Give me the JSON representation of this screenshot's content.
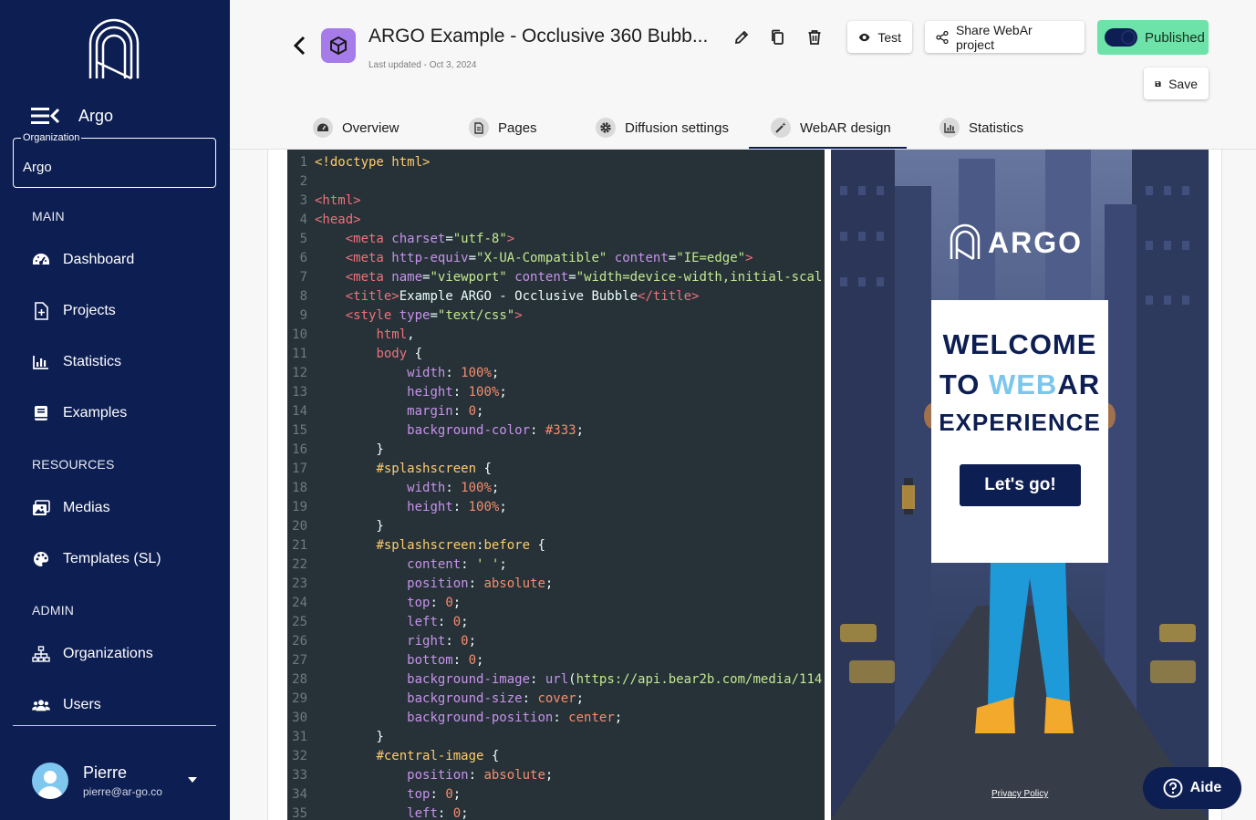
{
  "sidebar": {
    "org_label": "Argo",
    "org_field": {
      "legend": "Organization",
      "value": "Argo"
    },
    "sections": {
      "main": "MAIN",
      "resources": "RESOURCES",
      "admin": "ADMIN"
    },
    "items": [
      {
        "label": "Dashboard",
        "icon": "dashboard-icon"
      },
      {
        "label": "Projects",
        "icon": "file-plus-icon"
      },
      {
        "label": "Statistics",
        "icon": "bar-chart-icon"
      },
      {
        "label": "Examples",
        "icon": "book-icon"
      },
      {
        "label": "Medias",
        "icon": "images-icon"
      },
      {
        "label": "Templates (SL)",
        "icon": "palette-icon"
      },
      {
        "label": "Organizations",
        "icon": "sitemap-icon"
      },
      {
        "label": "Users",
        "icon": "users-icon"
      }
    ],
    "user": {
      "name": "Pierre",
      "email": "pierre@ar-go.co"
    }
  },
  "header": {
    "title": "ARGO Example - Occlusive 360 Bubb...",
    "updated": "Last updated - Oct 3, 2024",
    "test_label": "Test",
    "share_label": "Share WebAr project",
    "published_label": "Published",
    "save_label": "Save"
  },
  "tabs": [
    {
      "label": "Overview"
    },
    {
      "label": "Pages"
    },
    {
      "label": "Diffusion settings"
    },
    {
      "label": "WebAR design",
      "active": true
    },
    {
      "label": "Statistics"
    }
  ],
  "code_lines": [
    [
      [
        "tk-sel",
        "<!doctype html>"
      ]
    ],
    [],
    [
      [
        "tk-tag",
        "<html>"
      ]
    ],
    [
      [
        "tk-tag",
        "<head>"
      ]
    ],
    [
      [
        "tk-plain",
        "    "
      ],
      [
        "tk-tag",
        "<meta "
      ],
      [
        "tk-attr",
        "charset"
      ],
      [
        "tk-plain",
        "="
      ],
      [
        "tk-str",
        "\"utf-8\""
      ],
      [
        "tk-tag",
        ">"
      ]
    ],
    [
      [
        "tk-plain",
        "    "
      ],
      [
        "tk-tag",
        "<meta "
      ],
      [
        "tk-attr",
        "http-equiv"
      ],
      [
        "tk-plain",
        "="
      ],
      [
        "tk-str",
        "\"X-UA-Compatible\""
      ],
      [
        "tk-plain",
        " "
      ],
      [
        "tk-attr",
        "content"
      ],
      [
        "tk-plain",
        "="
      ],
      [
        "tk-str",
        "\"IE=edge\""
      ],
      [
        "tk-tag",
        ">"
      ]
    ],
    [
      [
        "tk-plain",
        "    "
      ],
      [
        "tk-tag",
        "<meta "
      ],
      [
        "tk-attr",
        "name"
      ],
      [
        "tk-plain",
        "="
      ],
      [
        "tk-str",
        "\"viewport\""
      ],
      [
        "tk-plain",
        " "
      ],
      [
        "tk-attr",
        "content"
      ],
      [
        "tk-plain",
        "="
      ],
      [
        "tk-str",
        "\"width=device-width,initial-scal"
      ]
    ],
    [
      [
        "tk-plain",
        "    "
      ],
      [
        "tk-tag",
        "<title>"
      ],
      [
        "tk-plain",
        "Example ARGO - Occlusive Bubble"
      ],
      [
        "tk-tag",
        "</title>"
      ]
    ],
    [
      [
        "tk-plain",
        "    "
      ],
      [
        "tk-tag",
        "<style "
      ],
      [
        "tk-attr",
        "type"
      ],
      [
        "tk-plain",
        "="
      ],
      [
        "tk-str",
        "\"text/css\""
      ],
      [
        "tk-tag",
        ">"
      ]
    ],
    [
      [
        "tk-plain",
        "        "
      ],
      [
        "tk-tag",
        "html"
      ],
      [
        "tk-plain",
        ","
      ]
    ],
    [
      [
        "tk-plain",
        "        "
      ],
      [
        "tk-tag",
        "body"
      ],
      [
        "tk-plain",
        " {"
      ]
    ],
    [
      [
        "tk-plain",
        "            "
      ],
      [
        "tk-prop",
        "width"
      ],
      [
        "tk-plain",
        ": "
      ],
      [
        "tk-num",
        "100%"
      ],
      [
        "tk-plain",
        ";"
      ]
    ],
    [
      [
        "tk-plain",
        "            "
      ],
      [
        "tk-prop",
        "height"
      ],
      [
        "tk-plain",
        ": "
      ],
      [
        "tk-num",
        "100%"
      ],
      [
        "tk-plain",
        ";"
      ]
    ],
    [
      [
        "tk-plain",
        "            "
      ],
      [
        "tk-prop",
        "margin"
      ],
      [
        "tk-plain",
        ": "
      ],
      [
        "tk-num",
        "0"
      ],
      [
        "tk-plain",
        ";"
      ]
    ],
    [
      [
        "tk-plain",
        "            "
      ],
      [
        "tk-prop",
        "background-color"
      ],
      [
        "tk-plain",
        ": "
      ],
      [
        "tk-num",
        "#333"
      ],
      [
        "tk-plain",
        ";"
      ]
    ],
    [
      [
        "tk-plain",
        "        }"
      ]
    ],
    [
      [
        "tk-plain",
        "        "
      ],
      [
        "tk-sel",
        "#splashscreen"
      ],
      [
        "tk-plain",
        " {"
      ]
    ],
    [
      [
        "tk-plain",
        "            "
      ],
      [
        "tk-prop",
        "width"
      ],
      [
        "tk-plain",
        ": "
      ],
      [
        "tk-num",
        "100%"
      ],
      [
        "tk-plain",
        ";"
      ]
    ],
    [
      [
        "tk-plain",
        "            "
      ],
      [
        "tk-prop",
        "height"
      ],
      [
        "tk-plain",
        ": "
      ],
      [
        "tk-num",
        "100%"
      ],
      [
        "tk-plain",
        ";"
      ]
    ],
    [
      [
        "tk-plain",
        "        }"
      ]
    ],
    [
      [
        "tk-plain",
        "        "
      ],
      [
        "tk-sel",
        "#splashscreen"
      ],
      [
        "tk-plain",
        ":"
      ],
      [
        "tk-sel",
        "before"
      ],
      [
        "tk-plain",
        " {"
      ]
    ],
    [
      [
        "tk-plain",
        "            "
      ],
      [
        "tk-prop",
        "content"
      ],
      [
        "tk-plain",
        ": "
      ],
      [
        "tk-str",
        "' '"
      ],
      [
        "tk-plain",
        ";"
      ]
    ],
    [
      [
        "tk-plain",
        "            "
      ],
      [
        "tk-prop",
        "position"
      ],
      [
        "tk-plain",
        ": "
      ],
      [
        "tk-val",
        "absolute"
      ],
      [
        "tk-plain",
        ";"
      ]
    ],
    [
      [
        "tk-plain",
        "            "
      ],
      [
        "tk-prop",
        "top"
      ],
      [
        "tk-plain",
        ": "
      ],
      [
        "tk-num",
        "0"
      ],
      [
        "tk-plain",
        ";"
      ]
    ],
    [
      [
        "tk-plain",
        "            "
      ],
      [
        "tk-prop",
        "left"
      ],
      [
        "tk-plain",
        ": "
      ],
      [
        "tk-num",
        "0"
      ],
      [
        "tk-plain",
        ";"
      ]
    ],
    [
      [
        "tk-plain",
        "            "
      ],
      [
        "tk-prop",
        "right"
      ],
      [
        "tk-plain",
        ": "
      ],
      [
        "tk-num",
        "0"
      ],
      [
        "tk-plain",
        ";"
      ]
    ],
    [
      [
        "tk-plain",
        "            "
      ],
      [
        "tk-prop",
        "bottom"
      ],
      [
        "tk-plain",
        ": "
      ],
      [
        "tk-num",
        "0"
      ],
      [
        "tk-plain",
        ";"
      ]
    ],
    [
      [
        "tk-plain",
        "            "
      ],
      [
        "tk-prop",
        "background-image"
      ],
      [
        "tk-plain",
        ": "
      ],
      [
        "tk-attr",
        "url"
      ],
      [
        "tk-plain",
        "("
      ],
      [
        "tk-str",
        "https://api.bear2b.com/media/114"
      ]
    ],
    [
      [
        "tk-plain",
        "            "
      ],
      [
        "tk-prop",
        "background-size"
      ],
      [
        "tk-plain",
        ": "
      ],
      [
        "tk-val",
        "cover"
      ],
      [
        "tk-plain",
        ";"
      ]
    ],
    [
      [
        "tk-plain",
        "            "
      ],
      [
        "tk-prop",
        "background-position"
      ],
      [
        "tk-plain",
        ": "
      ],
      [
        "tk-val",
        "center"
      ],
      [
        "tk-plain",
        ";"
      ]
    ],
    [
      [
        "tk-plain",
        "        }"
      ]
    ],
    [
      [
        "tk-plain",
        "        "
      ],
      [
        "tk-sel",
        "#central-image"
      ],
      [
        "tk-plain",
        " {"
      ]
    ],
    [
      [
        "tk-plain",
        "            "
      ],
      [
        "tk-prop",
        "position"
      ],
      [
        "tk-plain",
        ": "
      ],
      [
        "tk-val",
        "absolute"
      ],
      [
        "tk-plain",
        ";"
      ]
    ],
    [
      [
        "tk-plain",
        "            "
      ],
      [
        "tk-prop",
        "top"
      ],
      [
        "tk-plain",
        ": "
      ],
      [
        "tk-num",
        "0"
      ],
      [
        "tk-plain",
        ";"
      ]
    ],
    [
      [
        "tk-plain",
        "            "
      ],
      [
        "tk-prop",
        "left"
      ],
      [
        "tk-plain",
        ": "
      ],
      [
        "tk-num",
        "0"
      ],
      [
        "tk-plain",
        ";"
      ]
    ]
  ],
  "preview": {
    "brand": "ARGO",
    "welcome_1": "WELCOME",
    "welcome_2a": "TO ",
    "welcome_2b": "WEB",
    "welcome_2c": "AR",
    "welcome_3": "EXPERIENCE",
    "cta": "Let's go!",
    "privacy": "Privacy Policy"
  },
  "aide_label": "Aide",
  "colors": {
    "sidebar": "#0d1e52",
    "published": "#6de3a9",
    "accent_purple": "#a57ce9",
    "editor_bg": "#263238"
  }
}
